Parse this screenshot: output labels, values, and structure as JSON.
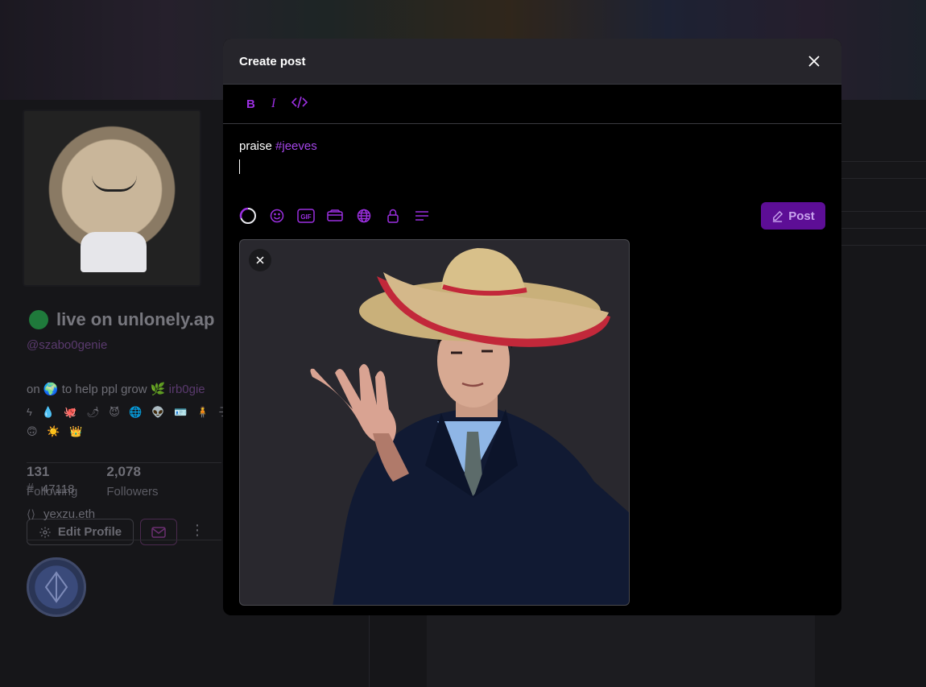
{
  "profile": {
    "name": "live on unlonely.ap",
    "handle": "@szabo0genie",
    "bio_line1_prefix": "on 🌍 to help ppl grow 🌿",
    "bio_line1_link": "irb0gie",
    "bio_line2": "ϟ 💧 🐙 🌶 😈 🌐 👽 🪪 🧍 子 💎",
    "bio_line3": "🙃 ☀️ 👑",
    "following_count": "131",
    "following_label": "Following",
    "followers_count": "2,078",
    "followers_label": "Followers",
    "edit_profile_label": "Edit Profile",
    "id_number": "47118",
    "ens_name": "yexzu.eth"
  },
  "modal": {
    "title": "Create post",
    "format_bold": "B",
    "format_italic": "I",
    "editor_text": "praise ",
    "editor_hashtag": "#jeeves",
    "post_label": "Post",
    "gif_label": "GIF"
  },
  "colors": {
    "accent": "#9b2fe0",
    "post_button_bg": "#5d0e96",
    "hashtag": "#a445e8"
  }
}
